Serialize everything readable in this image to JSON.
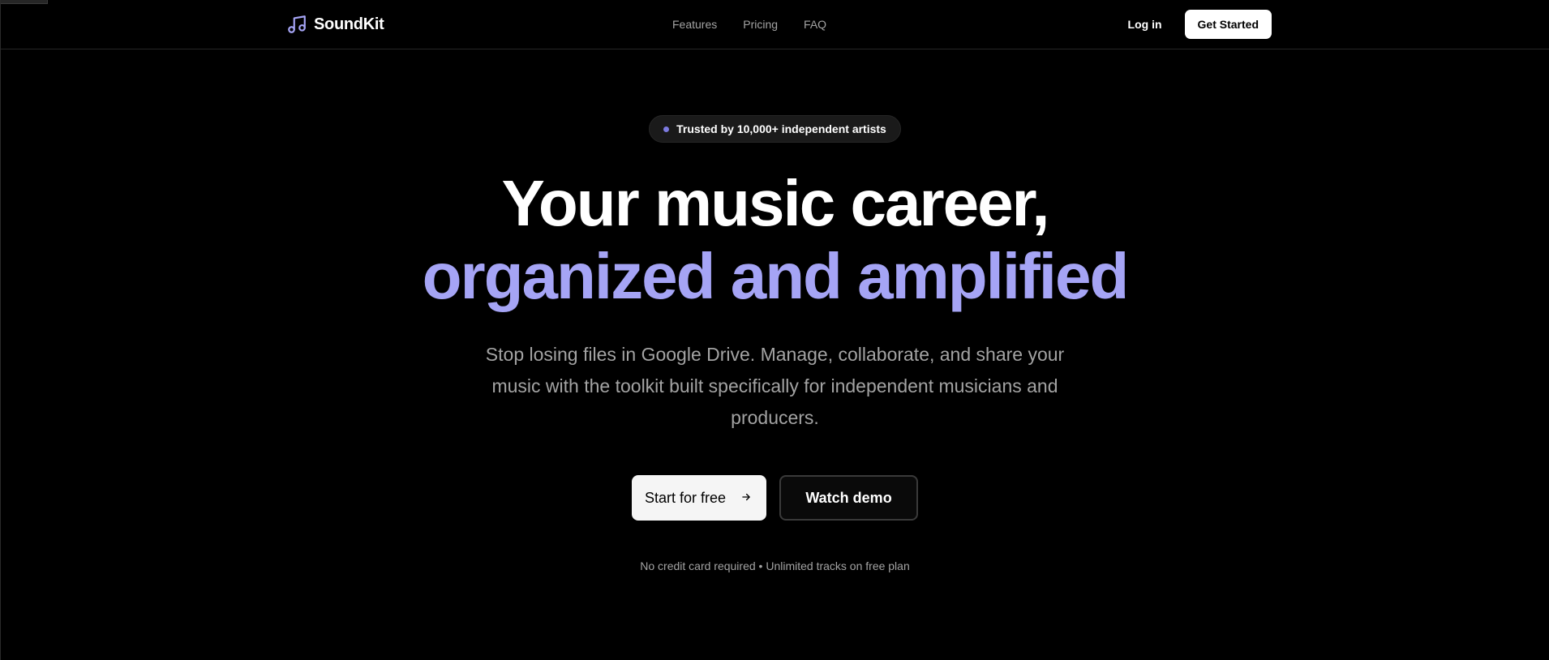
{
  "nav": {
    "brand": "SoundKit",
    "logo_icon": "music-note-icon",
    "links": [
      "Features",
      "Pricing",
      "FAQ"
    ],
    "login": "Log in",
    "cta": "Get Started"
  },
  "hero": {
    "badge": "Trusted by 10,000+ independent artists",
    "headline_line1": "Your music career,",
    "headline_line2": "organized and amplified",
    "subtext": "Stop losing files in Google Drive. Manage, collaborate, and share your music with the toolkit built specifically for independent musicians and producers.",
    "primary_cta": "Start for free",
    "primary_cta_icon": "arrow-right-icon",
    "secondary_cta": "Watch demo",
    "note": "No credit card required • Unlimited tracks on free plan"
  },
  "colors": {
    "background": "#000000",
    "accent": "#a5a4f5",
    "muted_text": "#a3a3a3"
  }
}
